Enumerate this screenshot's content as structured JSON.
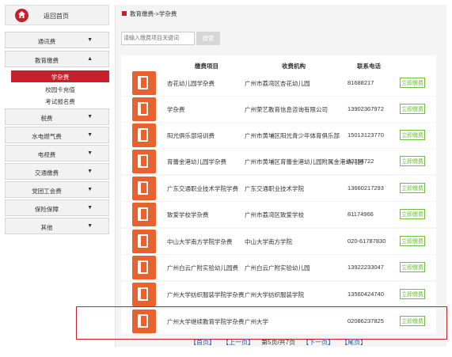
{
  "sidebar": {
    "home_label": "返回首页",
    "groups": [
      {
        "label": "通讯费",
        "arrow": "▼"
      },
      {
        "label": "教育缴费",
        "arrow": "▲"
      },
      {
        "label": "税费",
        "arrow": "▼"
      },
      {
        "label": "水电燃气费",
        "arrow": "▼"
      },
      {
        "label": "电视费",
        "arrow": "▼"
      },
      {
        "label": "交通缴费",
        "arrow": "▼"
      },
      {
        "label": "党团工会费",
        "arrow": "▼"
      },
      {
        "label": "保险保障",
        "arrow": "▼"
      },
      {
        "label": "其他",
        "arrow": "▼"
      }
    ],
    "sub_items": [
      {
        "label": "学杂费"
      },
      {
        "label": "校园卡充值"
      },
      {
        "label": "考试报名费"
      }
    ]
  },
  "main": {
    "breadcrumb": "教育缴费->学杂费",
    "search_placeholder": "请输入缴费项目关键词",
    "search_button": "搜索",
    "headers": [
      "缴费项目",
      "收费机构",
      "联系电话"
    ],
    "pay_label": "立即缴费",
    "rows": [
      {
        "item": "杏花幼儿园学杂费",
        "org": "广州市荔湾区杏花幼儿园",
        "tel": "81688217"
      },
      {
        "item": "学杂费",
        "org": "广州荣艺教育信息咨询有限公司",
        "tel": "13902367972"
      },
      {
        "item": "阳光俱乐部培训费",
        "org": "广州市黄埔区阳光青少年体育俱乐部",
        "tel": "15013123770"
      },
      {
        "item": "育蕾金港幼儿园学杂费",
        "org": "广州市黄埔区育蕾金港幼儿园附属金港幼儿园",
        "tel": "82354722"
      },
      {
        "item": "广东交通职业技术学院学费",
        "org": "广东交通职业技术学院",
        "tel": "13660217293"
      },
      {
        "item": "致爱学校学杂费",
        "org": "广州市荔湾区致爱学校",
        "tel": "81174966"
      },
      {
        "item": "中山大学南方学院学杂费",
        "org": "中山大学南方学院",
        "tel": "020-61787830"
      },
      {
        "item": "广州白云广附实验幼儿园费",
        "org": "广州白云广附实验幼儿园",
        "tel": "13922233047"
      },
      {
        "item": "广州大学纺织服装学院学杂费",
        "org": "广州大学纺织服装学院",
        "tel": "13560424740"
      },
      {
        "item": "广州大学继续教育学院学杂费",
        "org": "广州大学",
        "tel": "02086237825"
      }
    ]
  },
  "pager": {
    "first": "首页",
    "prev": "上一页",
    "info": "第5页/共7页",
    "next": "下一页",
    "last": "尾页"
  },
  "colors": {
    "accent": "#c8202a",
    "pay_green": "#6bbf3a",
    "book_orange": "#e8622f",
    "link_blue": "#1e50a2"
  }
}
